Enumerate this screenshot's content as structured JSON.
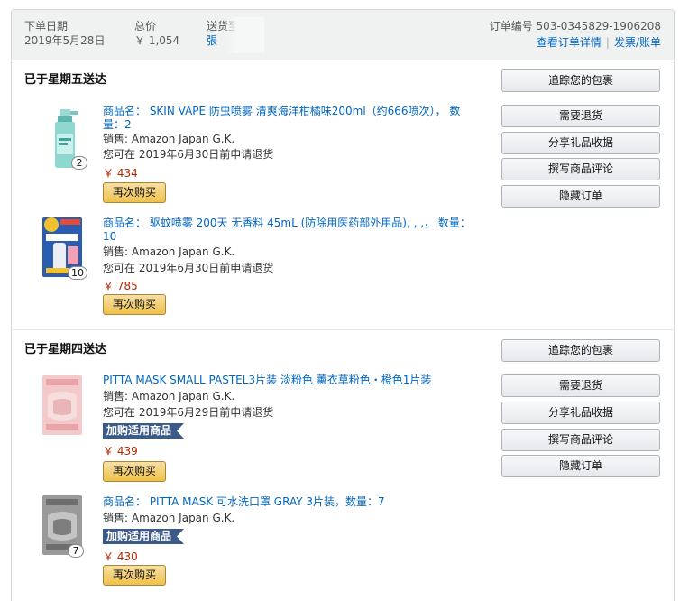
{
  "header": {
    "order_date_label": "下单日期",
    "order_date": "2019年5月28日",
    "total_label": "总价",
    "total": "￥ 1,054",
    "ship_to_label": "送货至",
    "ship_to": "張",
    "order_number_label": "订单编号",
    "order_number": "503-0345829-1906208",
    "view_details": "查看订单详情",
    "invoice": "发票/账单"
  },
  "shipments": [
    {
      "title": "已于星期五送达",
      "buttons": [
        "追踪您的包裹",
        "需要退货",
        "分享礼品收据",
        "撰写商品评论",
        "隐藏订单"
      ],
      "items": [
        {
          "title": "商品名： SKIN VAPE 防虫喷雾 清爽海洋柑橘味200ml（约666喷次）， 数量：2",
          "qty": "2",
          "seller": "销售: Amazon Japan G.K.",
          "return": "您可在 2019年6月30日前申请退货",
          "price": "￥ 434",
          "buy_again": "再次购买"
        },
        {
          "title": "商品名： 驱蚊喷雾 200天 无香料 45mL (防除用医药部外用品), , ,， 数量：10",
          "qty": "10",
          "seller": "销售: Amazon Japan G.K.",
          "return": "您可在 2019年6月30日前申请退货",
          "price": "￥ 785",
          "buy_again": "再次购买"
        }
      ]
    },
    {
      "title": "已于星期四送达",
      "buttons": [
        "追踪您的包裹",
        "需要退货",
        "分享礼品收据",
        "撰写商品评论",
        "隐藏订单"
      ],
      "items": [
        {
          "title": "PITTA MASK SMALL PASTEL3片装 淡粉色 薰衣草粉色・橙色1片装",
          "seller": "销售: Amazon Japan G.K.",
          "return": "您可在 2019年6月29日前申请退货",
          "addon": "加购适用商品",
          "price": "￥ 439",
          "buy_again": "再次购买"
        },
        {
          "title": "商品名： PITTA MASK 可水洗口罩 GRAY 3片装，数量：7",
          "qty": "7",
          "seller": "销售: Amazon Japan G.K.",
          "addon": "加购适用商品",
          "price": "￥ 430",
          "buy_again": "再次购买"
        }
      ]
    }
  ]
}
